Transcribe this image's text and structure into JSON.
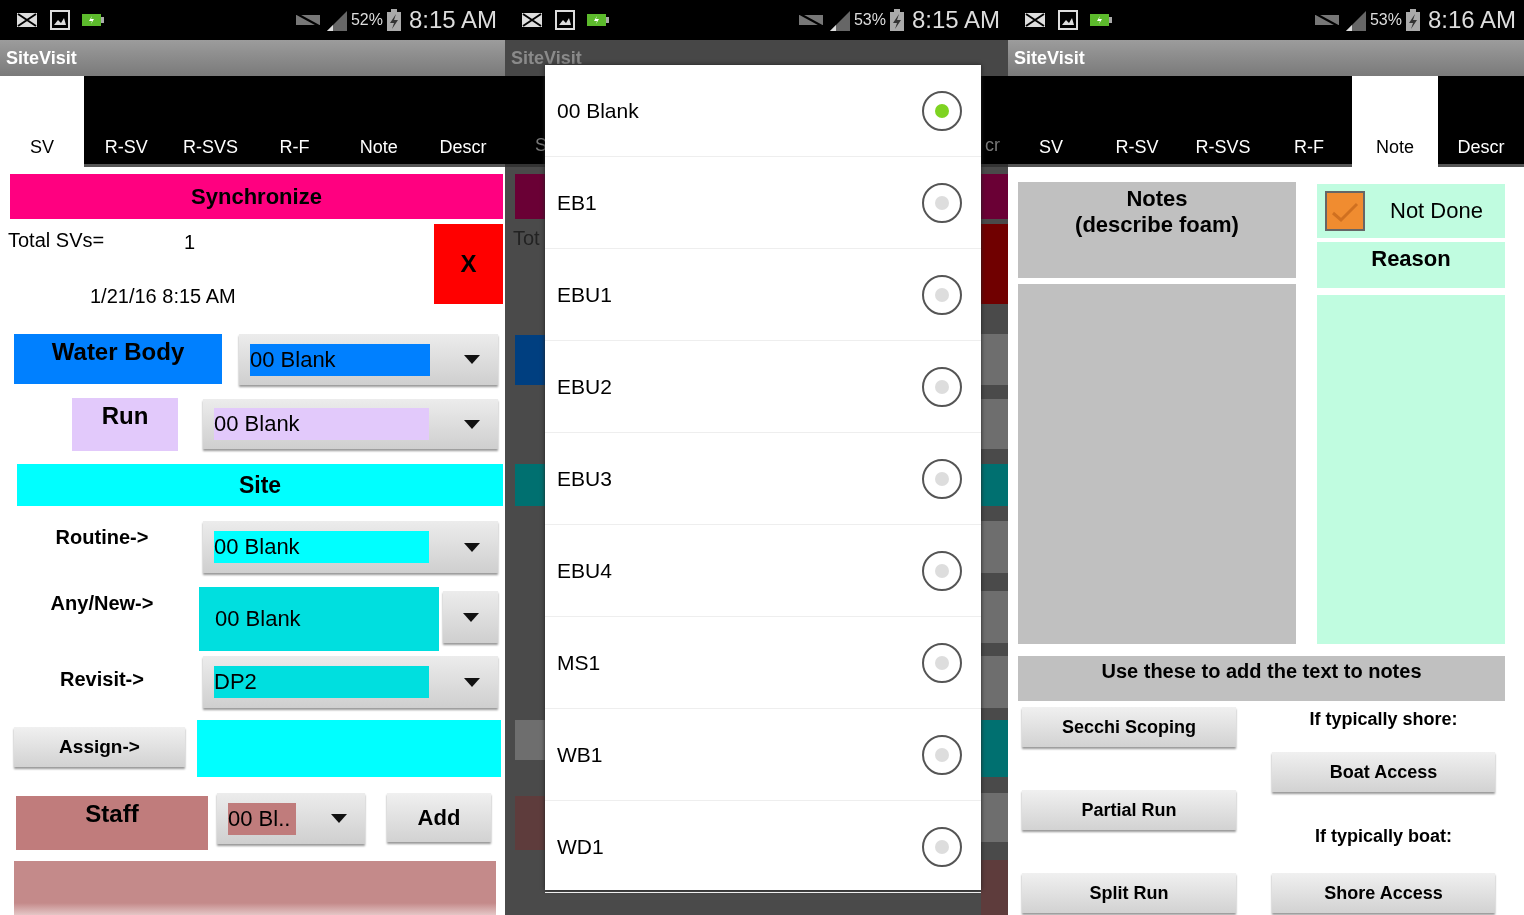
{
  "panels": [
    {
      "kind": "sv_form",
      "status_bar": {
        "battery": "52%",
        "time": "8:15 AM"
      },
      "title": "SiteVisit",
      "tabs": [
        {
          "label": "SV",
          "selected": true
        },
        {
          "label": "R-SV",
          "selected": false
        },
        {
          "label": "R-SVS",
          "selected": false
        },
        {
          "label": "R-F",
          "selected": false
        },
        {
          "label": "Note",
          "selected": false
        },
        {
          "label": "Descr",
          "selected": false
        }
      ],
      "sync_button": "Synchronize",
      "total_label": "Total SVs=",
      "total_value": "1",
      "datetime": "1/21/16 8:15 AM",
      "close_button": "X",
      "water_body": {
        "label": "Water Body",
        "value": "00 Blank"
      },
      "run": {
        "label": "Run",
        "value": "00 Blank"
      },
      "site_header": "Site",
      "routine": {
        "label": "Routine->",
        "value": "00 Blank"
      },
      "any_new": {
        "label": "Any/New->",
        "value": "00 Blank"
      },
      "revisit": {
        "label": "Revisit->",
        "value": "DP2"
      },
      "assign_button": "Assign->",
      "staff": {
        "label": "Staff",
        "value": "00 Bl.."
      },
      "add_button": "Add"
    },
    {
      "kind": "picker",
      "status_bar": {
        "battery": "53%",
        "time": "8:15 AM"
      },
      "title": "SiteVisit",
      "background_fragments": {
        "tab_left": "S",
        "tab_right": "cr",
        "total": "Tot"
      },
      "options": [
        {
          "label": "00 Blank",
          "selected": true
        },
        {
          "label": "EB1",
          "selected": false
        },
        {
          "label": "EBU1",
          "selected": false
        },
        {
          "label": "EBU2",
          "selected": false
        },
        {
          "label": "EBU3",
          "selected": false
        },
        {
          "label": "EBU4",
          "selected": false
        },
        {
          "label": "MS1",
          "selected": false
        },
        {
          "label": "WB1",
          "selected": false
        },
        {
          "label": "WD1",
          "selected": false
        }
      ]
    },
    {
      "kind": "notes",
      "status_bar": {
        "battery": "53%",
        "time": "8:16 AM"
      },
      "title": "SiteVisit",
      "tabs": [
        {
          "label": "SV",
          "selected": false
        },
        {
          "label": "R-SV",
          "selected": false
        },
        {
          "label": "R-SVS",
          "selected": false
        },
        {
          "label": "R-F",
          "selected": false
        },
        {
          "label": "Note",
          "selected": true
        },
        {
          "label": "Descr",
          "selected": false
        }
      ],
      "notes_header": "Notes\n(describe foam)",
      "not_done": {
        "label": "Not Done",
        "checked": true
      },
      "reason_header": "Reason",
      "insert_header": "Use these to add the text to notes",
      "left_buttons": [
        "Secchi Scoping",
        "Partial Run",
        "Split Run"
      ],
      "shore_label": "If typically shore:",
      "boat_access": "Boat Access",
      "boat_label": "If typically boat:",
      "shore_access": "Shore Access"
    }
  ]
}
